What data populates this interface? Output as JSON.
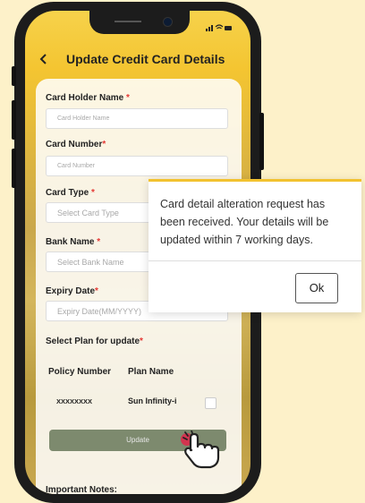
{
  "header": {
    "back_icon": "chevron-left-icon",
    "title": "Update Credit Card Details"
  },
  "status_bar": {
    "icons": [
      "signal-icon",
      "wifi-icon",
      "battery-icon"
    ]
  },
  "form": {
    "card_holder": {
      "label": "Card Holder Name",
      "required": "*",
      "placeholder": "Card Holder Name"
    },
    "card_number": {
      "label": "Card Number",
      "required": "*",
      "placeholder": "Card Number"
    },
    "card_type": {
      "label": "Card Type",
      "required": "*",
      "placeholder": "Select Card Type"
    },
    "bank_name": {
      "label": "Bank Name",
      "required": "*",
      "placeholder": "Select Bank Name"
    },
    "expiry": {
      "label": "Expiry Date",
      "required": "*",
      "placeholder": "Expiry Date(MM/YYYY)"
    }
  },
  "plan_section": {
    "label": "Select Plan for update",
    "required": "*",
    "headers": [
      "Policy Number",
      "Plan Name"
    ],
    "rows": [
      {
        "policy_number": "XXXXXXXX",
        "plan_name": "Sun Infinity-i",
        "checked": false
      }
    ]
  },
  "update_button": {
    "label": "Update"
  },
  "notes": {
    "label": "Important Notes:"
  },
  "dialog": {
    "message": "Card detail alteration request has been received. Your details will be updated within 7 working days.",
    "ok_label": "Ok"
  },
  "colors": {
    "accent": "#f2c230",
    "required": "#e53935",
    "background": "#fdf1c9",
    "update_button": "#7d8a6e"
  }
}
